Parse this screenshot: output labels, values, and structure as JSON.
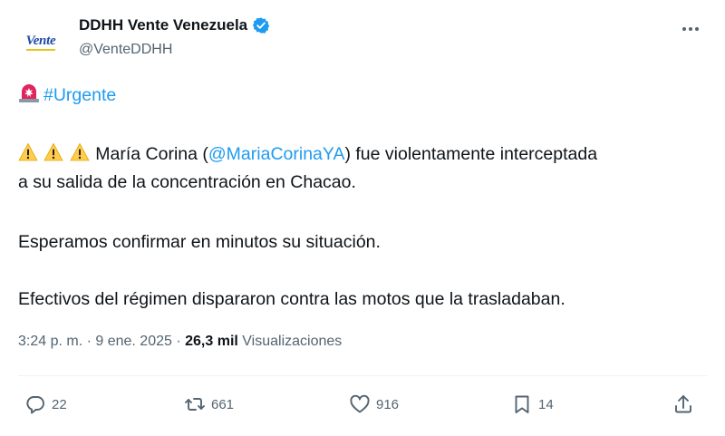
{
  "author": {
    "avatar_text": "Vente",
    "display_name": "DDHH Vente Venezuela",
    "verified_icon": "verified-badge-icon",
    "handle": "@VenteDDHH"
  },
  "more_icon": "more-dots-icon",
  "tweet": {
    "hashtag_line": {
      "icon": "siren-icon",
      "hashtag": "#Urgente"
    },
    "line1": {
      "icons": [
        "warning-icon",
        "warning-icon",
        "warning-icon"
      ],
      "before": " María Corina (",
      "mention": "@MariaCorinaYA",
      "after": ") fue violentamente interceptada"
    },
    "line2": "a su salida de la concentración en Chacao.",
    "line3": "Esperamos confirmar en minutos su situación.",
    "line4": "Efectivos del régimen dispararon contra las motos que la trasladaban."
  },
  "meta": {
    "time": "3:24 p. m.",
    "sep1": " · ",
    "date": "9 ene. 2025",
    "sep2": " · ",
    "views_count": "26,3 mil",
    "views_label": " Visualizaciones"
  },
  "actions": {
    "replies": "22",
    "reposts": "661",
    "likes": "916",
    "bookmarks": "14"
  },
  "colors": {
    "accent": "#1d9bf0",
    "text": "#0f1419",
    "muted": "#536471",
    "divider": "#eff3f4"
  }
}
